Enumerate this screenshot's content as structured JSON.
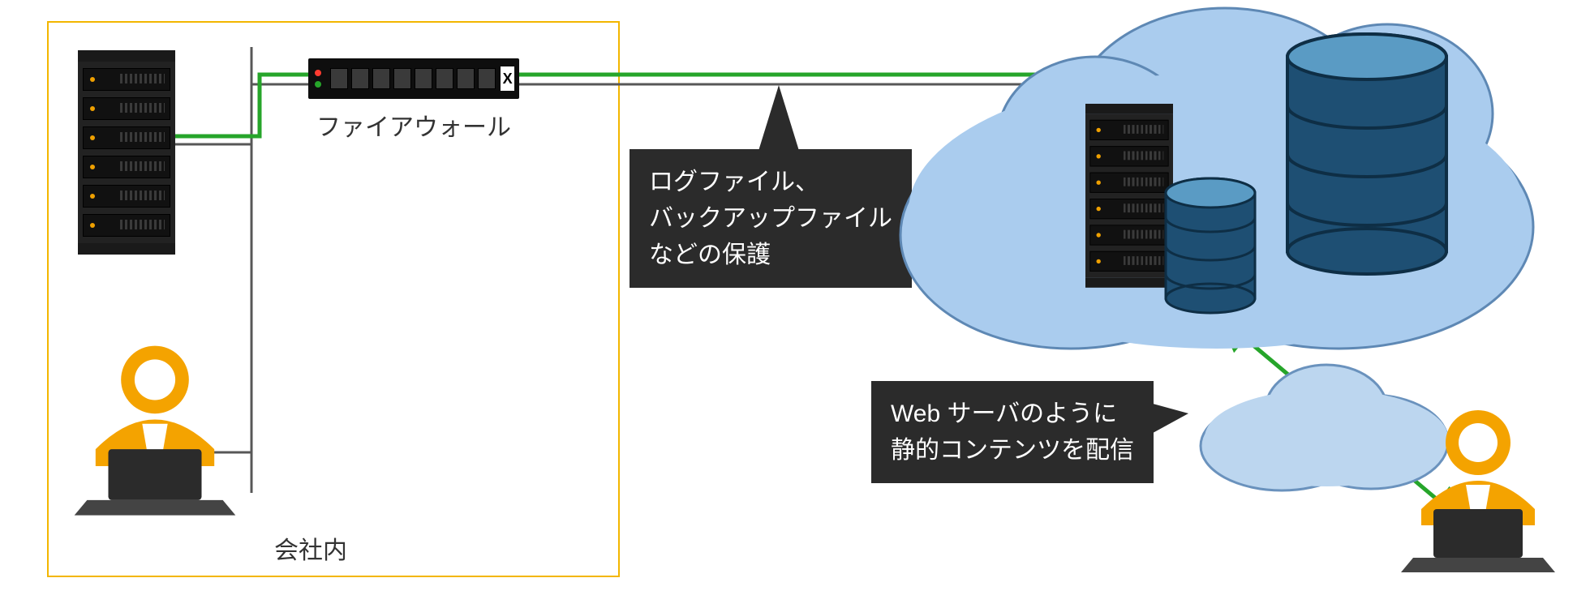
{
  "internal_label": "会社内",
  "firewall_label": "ファイアウォール",
  "callout1_line1": "ログファイル、",
  "callout1_line2": "バックアップファイル",
  "callout1_line3": "などの保護",
  "callout2_line1": "Web サーバのように",
  "callout2_line2": "静的コンテンツを配信",
  "colors": {
    "box_border": "#f3b600",
    "callout_bg": "#2b2b2b",
    "green_wire": "#26a52a",
    "gray_wire": "#575757",
    "cloud_fill": "#aaccee",
    "cloud_stroke": "#5e88b4",
    "db_top": "#3b7aa6",
    "db_side": "#1e4f73",
    "person_fill": "#f4a300"
  }
}
